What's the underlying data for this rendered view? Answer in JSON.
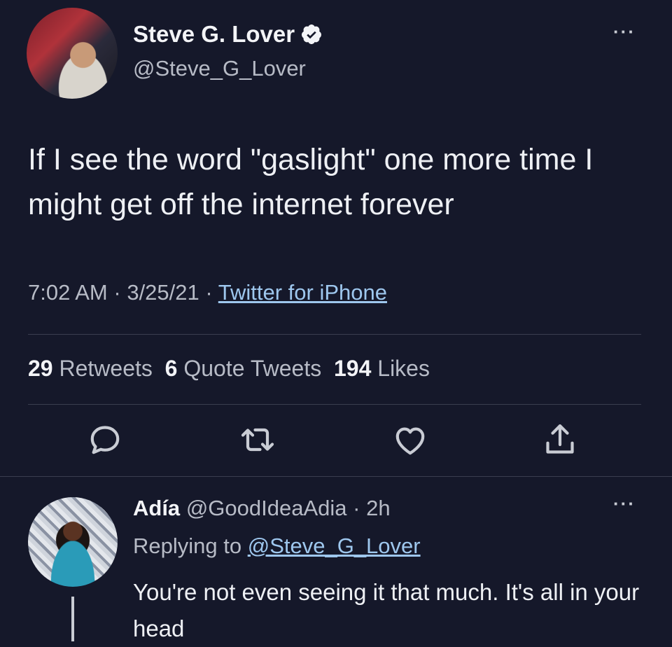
{
  "tweet": {
    "display_name": "Steve G. Lover",
    "handle": "@Steve_G_Lover",
    "verified": true,
    "text": "If I see the word \"gaslight\" one more time I might get off the internet forever",
    "time": "7:02 AM",
    "date": "3/25/21",
    "source": "Twitter for iPhone",
    "more_label": "···"
  },
  "stats": {
    "retweets_count": "29",
    "retweets_label": "Retweets",
    "quotes_count": "6",
    "quotes_label": "Quote Tweets",
    "likes_count": "194",
    "likes_label": "Likes"
  },
  "actions": [
    "reply-icon",
    "retweet-icon",
    "like-icon",
    "share-icon"
  ],
  "reply": {
    "display_name": "Adía",
    "handle": "@GoodIdeaAdia",
    "time_ago": "2h",
    "replying_prefix": "Replying to",
    "replying_to": "@Steve_G_Lover",
    "text": "You're not even seeing it that much. It's all in your head",
    "more_label": "···"
  },
  "colors": {
    "background": "#15182a",
    "link": "#9ec7ee",
    "secondary_text": "#b7bbc6"
  }
}
